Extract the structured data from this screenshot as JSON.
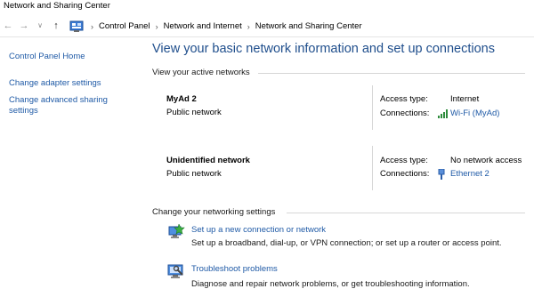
{
  "window": {
    "title": "Network and Sharing Center"
  },
  "address": {
    "crumbs": [
      "Control Panel",
      "Network and Internet",
      "Network and Sharing Center"
    ]
  },
  "sidebar": {
    "items": [
      {
        "label": "Control Panel Home"
      },
      {
        "label": "Change adapter settings"
      },
      {
        "label": "Change advanced sharing settings"
      }
    ]
  },
  "main": {
    "title": "View your basic network information and set up connections",
    "active_label": "View your active networks",
    "access_type_label": "Access type:",
    "connections_label": "Connections:",
    "networks": [
      {
        "name": "MyAd  2",
        "category": "Public network",
        "access_type": "Internet",
        "connection": "Wi-Fi (MyAd)",
        "connection_icon": "wifi-signal-icon"
      },
      {
        "name": "Unidentified network",
        "category": "Public network",
        "access_type": "No network access",
        "connection": "Ethernet 2",
        "connection_icon": "ethernet-icon"
      }
    ],
    "change_label": "Change your networking settings",
    "tasks": [
      {
        "link": "Set up a new connection or network",
        "desc": "Set up a broadband, dial-up, or VPN connection; or set up a router or access point.",
        "icon": "new-connection-icon"
      },
      {
        "link": "Troubleshoot problems",
        "desc": "Diagnose and repair network problems, or get troubleshooting information.",
        "icon": "troubleshoot-icon"
      }
    ]
  },
  "colors": {
    "link": "#1f5aa6",
    "title": "#1f4e8c",
    "rule": "#d6d6d6"
  }
}
